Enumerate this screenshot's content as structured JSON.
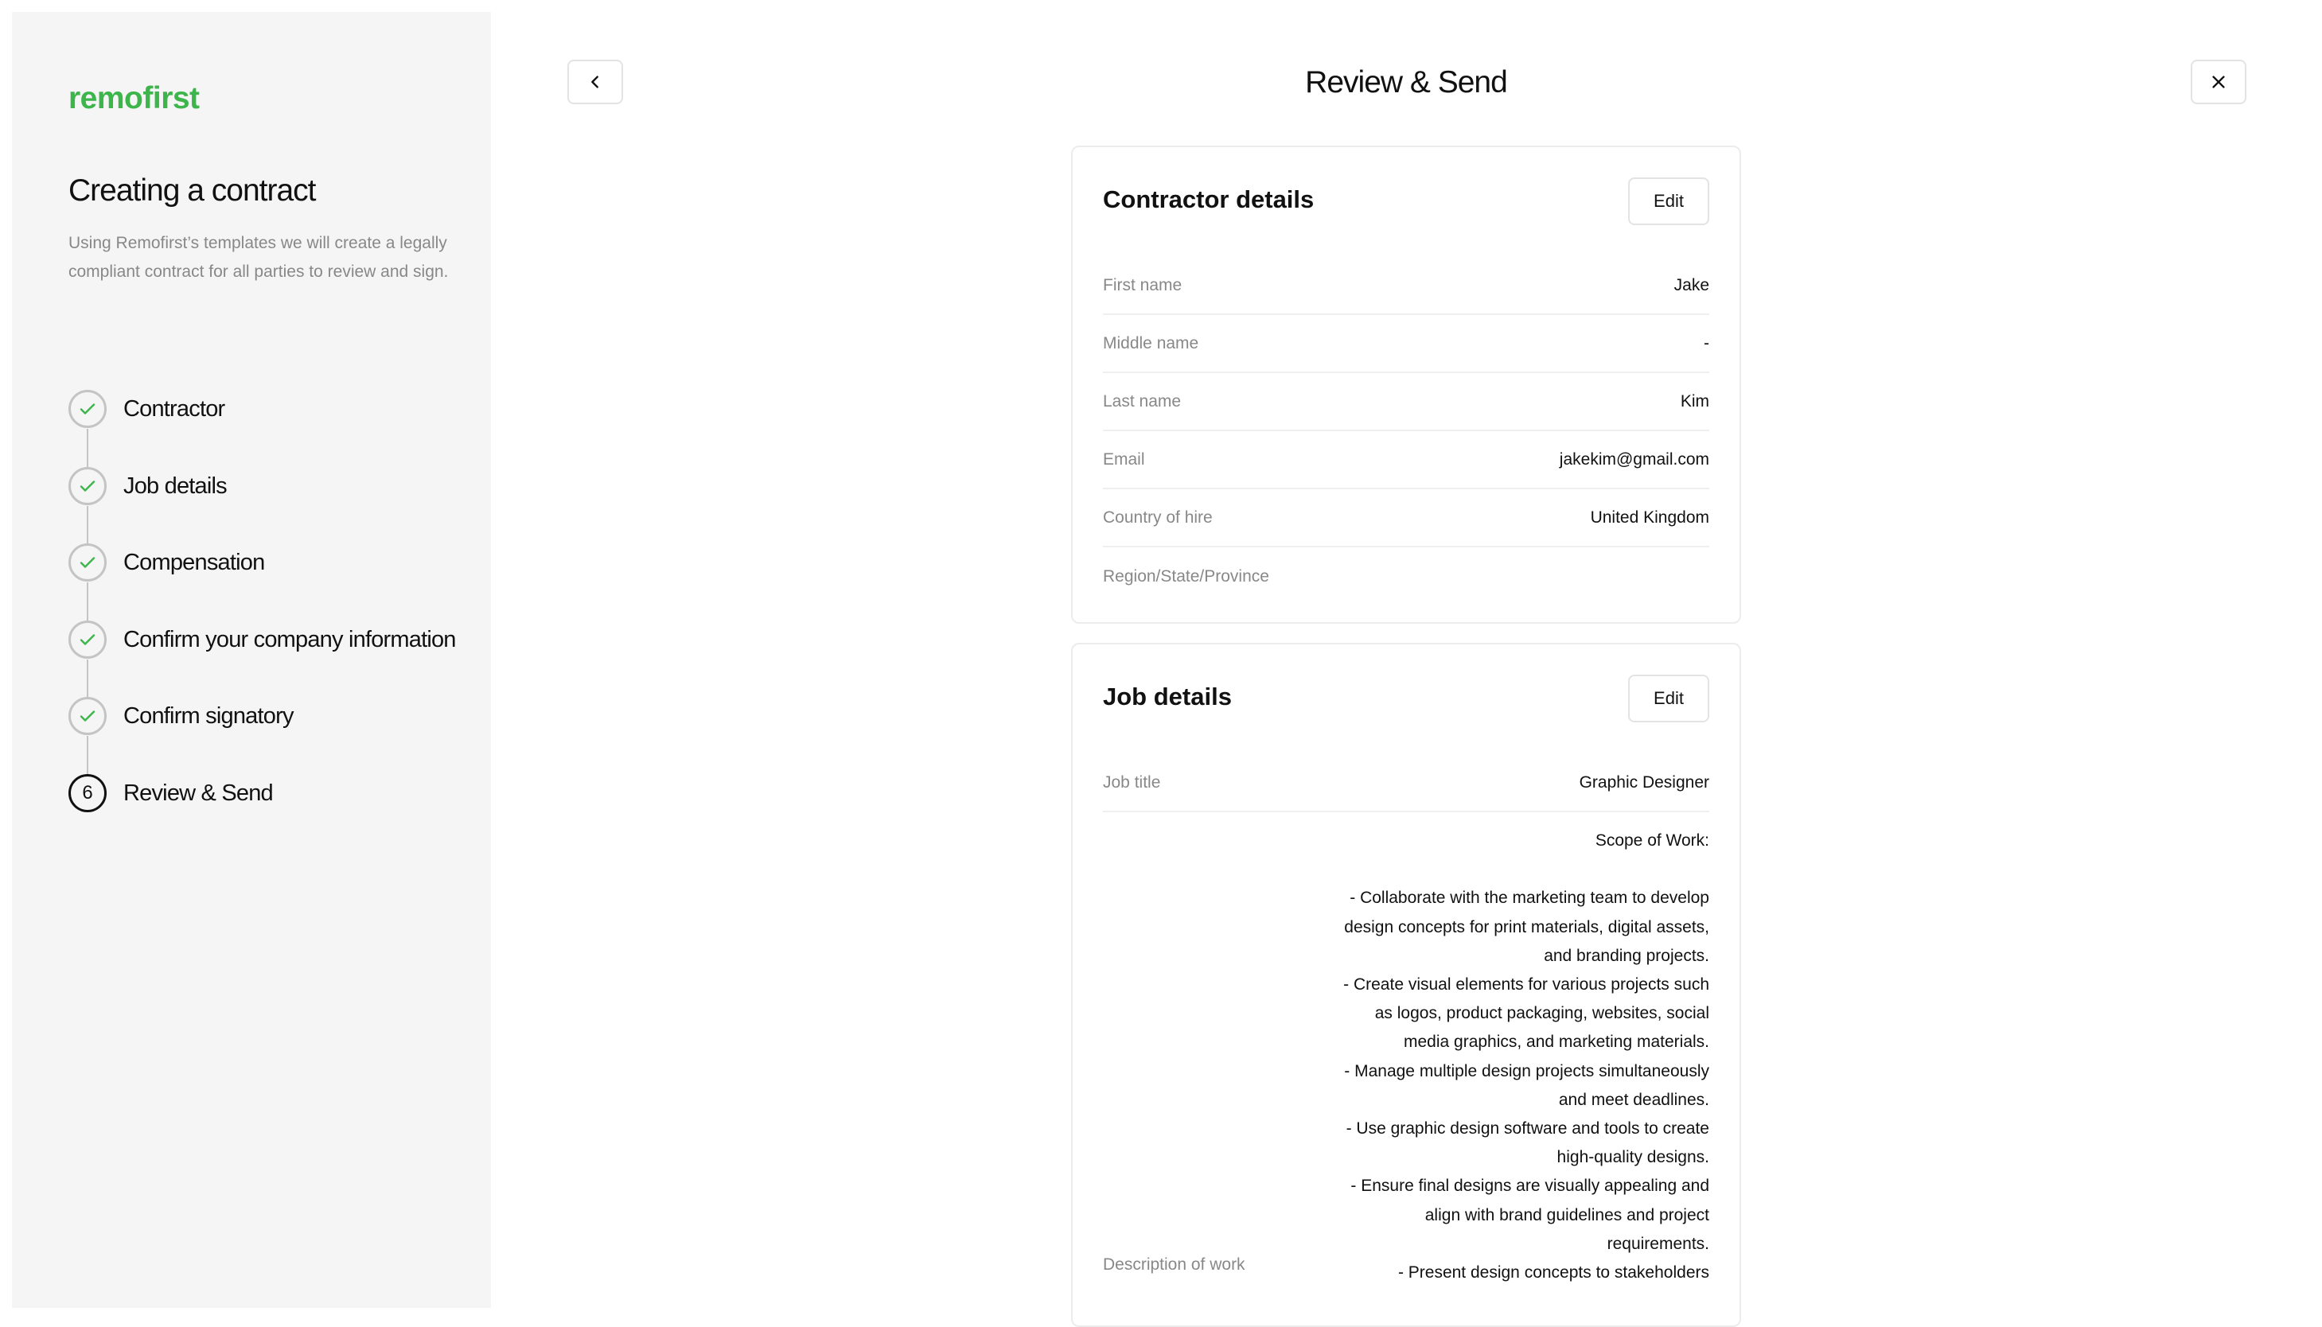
{
  "sidebar": {
    "logo": "remofirst",
    "title": "Creating a contract",
    "description": "Using Remofirst’s templates we will create a legally compliant contract for all parties to review and sign.",
    "steps": [
      {
        "label": "Contractor",
        "status": "done"
      },
      {
        "label": "Job details",
        "status": "done"
      },
      {
        "label": "Compensation",
        "status": "done"
      },
      {
        "label": "Confirm your company information",
        "status": "done"
      },
      {
        "label": "Confirm signatory",
        "status": "done"
      },
      {
        "label": "Review & Send",
        "status": "active",
        "number": "6"
      }
    ]
  },
  "header": {
    "title": "Review & Send",
    "back_icon": "chevron-left-icon",
    "close_icon": "close-icon"
  },
  "contractor": {
    "title": "Contractor details",
    "edit_label": "Edit",
    "rows": [
      {
        "label": "First name",
        "value": "Jake"
      },
      {
        "label": "Middle name",
        "value": "-"
      },
      {
        "label": "Last name",
        "value": "Kim"
      },
      {
        "label": "Email",
        "value": "jakekim@gmail.com"
      },
      {
        "label": "Country of hire",
        "value": "United Kingdom"
      },
      {
        "label": "Region/State/Province",
        "value": ""
      }
    ]
  },
  "job": {
    "title": "Job details",
    "edit_label": "Edit",
    "job_title_label": "Job title",
    "job_title_value": "Graphic Designer",
    "description_label": "Description of work",
    "description_value": "Scope of Work:\n\n- Collaborate with the marketing team to develop design concepts for print materials, digital assets, and branding projects.\n- Create visual elements for various projects such as logos, product packaging, websites, social media graphics, and marketing materials.\n- Manage multiple design projects simultaneously and meet deadlines.\n- Use graphic design software and tools to create high-quality designs.\n- Ensure final designs are visually appealing and align with brand guidelines and project requirements.\n- Present design concepts to stakeholders"
  },
  "colors": {
    "brand": "#3cb54a",
    "sidebar_bg": "#f5f5f5",
    "muted_text": "#888888"
  }
}
